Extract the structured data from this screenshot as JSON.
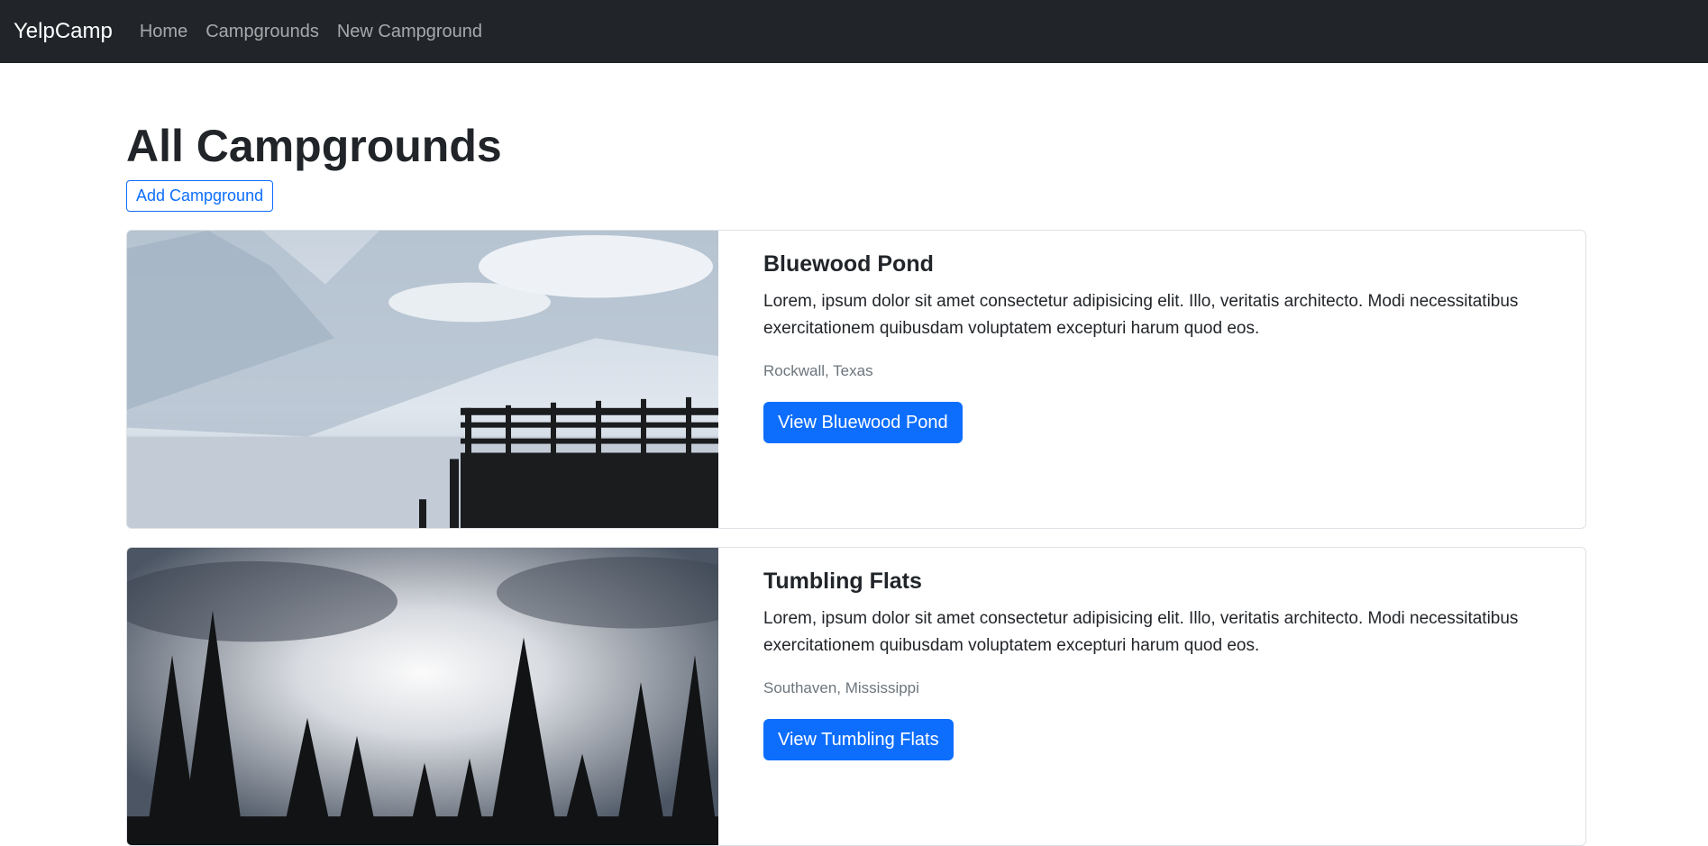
{
  "navbar": {
    "brand": "YelpCamp",
    "links": [
      "Home",
      "Campgrounds",
      "New Campground"
    ]
  },
  "page": {
    "title": "All Campgrounds",
    "add_button": "Add Campground"
  },
  "campgrounds": [
    {
      "title": "Bluewood Pond",
      "description": "Lorem, ipsum dolor sit amet consectetur adipisicing elit. Illo, veritatis architecto. Modi necessitatibus exercitationem quibusdam voluptatem excepturi harum quod eos.",
      "location": "Rockwall, Texas",
      "button": "View Bluewood Pond"
    },
    {
      "title": "Tumbling Flats",
      "description": "Lorem, ipsum dolor sit amet consectetur adipisicing elit. Illo, veritatis architecto. Modi necessitatibus exercitationem quibusdam voluptatem excepturi harum quod eos.",
      "location": "Southaven, Mississippi",
      "button": "View Tumbling Flats"
    }
  ],
  "colors": {
    "navbar_bg": "#212529",
    "primary": "#0d6efd",
    "muted_text": "#6c757d"
  }
}
